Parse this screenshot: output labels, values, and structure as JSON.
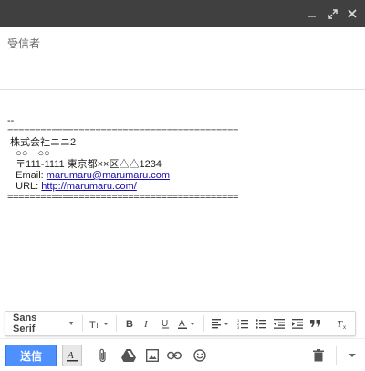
{
  "header": {
    "minimize_icon": "minimize-icon",
    "popout_icon": "popout-icon",
    "close_icon": "close-icon"
  },
  "fields": {
    "to_label": "受信者"
  },
  "body": {
    "lines": [
      "--",
      "==========================================",
      " 株式会社ニニ2",
      "   ○○　○○",
      "   〒111-1111 東京都××区△△1234",
      "   Email: ",
      "   URL: ",
      "=========================================="
    ],
    "email_link": "marumaru@marumaru.com",
    "url_link": "http://marumaru.com/"
  },
  "format_bar": {
    "font_family": "Sans Serif",
    "icons": [
      "text-size-icon",
      "bold-icon",
      "italic-icon",
      "underline-icon",
      "text-color-icon",
      "align-icon",
      "numbered-list-icon",
      "bulleted-list-icon",
      "indent-less-icon",
      "indent-more-icon",
      "quote-icon",
      "remove-formatting-icon"
    ]
  },
  "bottom_bar": {
    "send_label": "送信"
  }
}
